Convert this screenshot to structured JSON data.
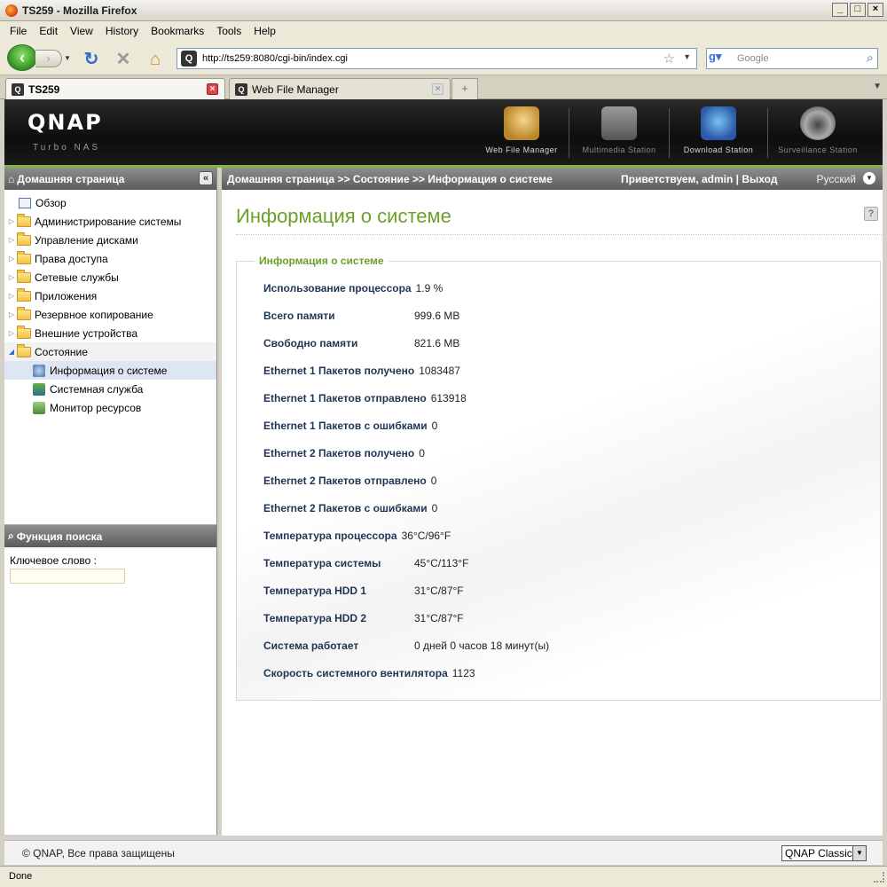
{
  "window": {
    "title": "TS259 - Mozilla Firefox"
  },
  "menu": [
    "File",
    "Edit",
    "View",
    "History",
    "Bookmarks",
    "Tools",
    "Help"
  ],
  "browser": {
    "url": "http://ts259:8080/cgi-bin/index.cgi",
    "search_placeholder": "Google",
    "tabs": [
      {
        "label": "TS259",
        "active": true
      },
      {
        "label": "Web File Manager",
        "active": false
      }
    ],
    "status": "Done"
  },
  "header": {
    "logo": "QNAP",
    "subtitle": "Turbo NAS",
    "stations": [
      {
        "label": "Web File Manager",
        "icon": "web-file-manager-icon"
      },
      {
        "label": "Multimedia Station",
        "icon": "multimedia-station-icon"
      },
      {
        "label": "Download Station",
        "icon": "download-station-icon"
      },
      {
        "label": "Surveillance Station",
        "icon": "surveillance-station-icon"
      }
    ]
  },
  "sidebar": {
    "title": "Домашняя страница",
    "items": [
      {
        "label": "Обзор",
        "type": "doc"
      },
      {
        "label": "Администрирование системы",
        "type": "folder"
      },
      {
        "label": "Управление дисками",
        "type": "folder"
      },
      {
        "label": "Права доступа",
        "type": "folder"
      },
      {
        "label": "Сетевые службы",
        "type": "folder"
      },
      {
        "label": "Приложения",
        "type": "folder"
      },
      {
        "label": "Резервное копирование",
        "type": "folder"
      },
      {
        "label": "Внешние устройства",
        "type": "folder"
      },
      {
        "label": "Состояние",
        "type": "folder-open"
      }
    ],
    "subitems": [
      {
        "label": "Информация о системе"
      },
      {
        "label": "Системная служба"
      },
      {
        "label": "Монитор ресурсов"
      }
    ],
    "search": {
      "title": "Функция поиска",
      "keyword_label": "Ключевое слово :",
      "keyword_value": ""
    }
  },
  "topbar": {
    "breadcrumb": "Домашняя страница >> Состояние >> Информация о системе",
    "greeting": "Приветствуем,  admin | Выход",
    "language": "Русский"
  },
  "main": {
    "title": "Информация о системе",
    "section_title": "Информация о системе",
    "rows": [
      {
        "label": "Использование процессора",
        "value": "1.9 %"
      },
      {
        "label": "Всего памяти",
        "value": "999.6 MB"
      },
      {
        "label": "Свободно памяти",
        "value": "821.6 MB"
      },
      {
        "label": "Ethernet 1 Пакетов получено",
        "value": "1083487"
      },
      {
        "label": "Ethernet 1 Пакетов отправлено",
        "value": "613918"
      },
      {
        "label": "Ethernet 1 Пакетов с ошибками",
        "value": "0"
      },
      {
        "label": "Ethernet 2 Пакетов получено",
        "value": "0"
      },
      {
        "label": "Ethernet 2 Пакетов отправлено",
        "value": "0"
      },
      {
        "label": "Ethernet 2 Пакетов с ошибками",
        "value": "0"
      },
      {
        "label": "Температура процессора",
        "value": "36°C/96°F"
      },
      {
        "label": "Температура системы",
        "value": "45°C/113°F"
      },
      {
        "label": "Температура HDD 1",
        "value": "31°C/87°F"
      },
      {
        "label": "Температура HDD 2",
        "value": "31°C/87°F"
      },
      {
        "label": "Система работает",
        "value": "0 дней 0 часов 18 минут(ы)"
      },
      {
        "label": "Скорость системного вентилятора",
        "value": "1123"
      }
    ]
  },
  "footer": {
    "copyright": "© QNAP, Все права защищены",
    "theme": "QNAP Classic"
  }
}
